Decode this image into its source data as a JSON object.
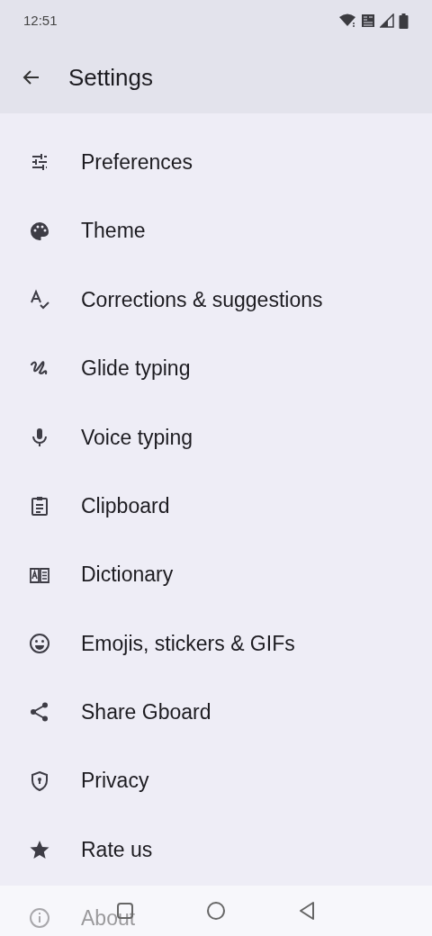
{
  "status_bar": {
    "time": "12:51"
  },
  "app_bar": {
    "title": "Settings"
  },
  "items": [
    {
      "label": "Preferences"
    },
    {
      "label": "Theme"
    },
    {
      "label": "Corrections & suggestions"
    },
    {
      "label": "Glide typing"
    },
    {
      "label": "Voice typing"
    },
    {
      "label": "Clipboard"
    },
    {
      "label": "Dictionary"
    },
    {
      "label": "Emojis, stickers & GIFs"
    },
    {
      "label": "Share Gboard"
    },
    {
      "label": "Privacy"
    },
    {
      "label": "Rate us"
    },
    {
      "label": "About"
    }
  ]
}
